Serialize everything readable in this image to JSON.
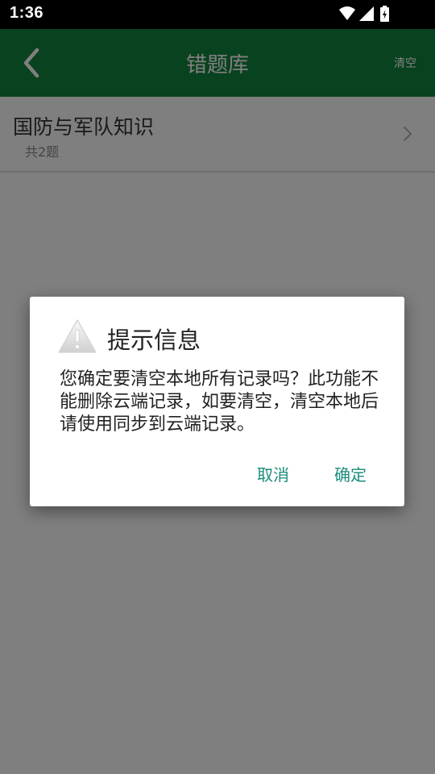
{
  "status_bar": {
    "time": "1:36",
    "icons": [
      "wifi-icon",
      "cellular-signal-icon",
      "battery-charging-icon"
    ]
  },
  "app_bar": {
    "title": "错题库",
    "clear_label": "清空",
    "back_icon": "chevron-left-icon"
  },
  "list": {
    "items": [
      {
        "title": "国防与军队知识",
        "subtitle": "共2题"
      }
    ]
  },
  "dialog": {
    "icon": "warning-icon",
    "title": "提示信息",
    "message": "您确定要清空本地所有记录吗？此功能不能删除云端记录，如要清空，清空本地后请使用同步到云端记录。",
    "cancel_label": "取消",
    "ok_label": "确定"
  },
  "colors": {
    "app_bar": "#12843f",
    "accent_text": "#1b8c7c",
    "status_bar": "#000000"
  }
}
